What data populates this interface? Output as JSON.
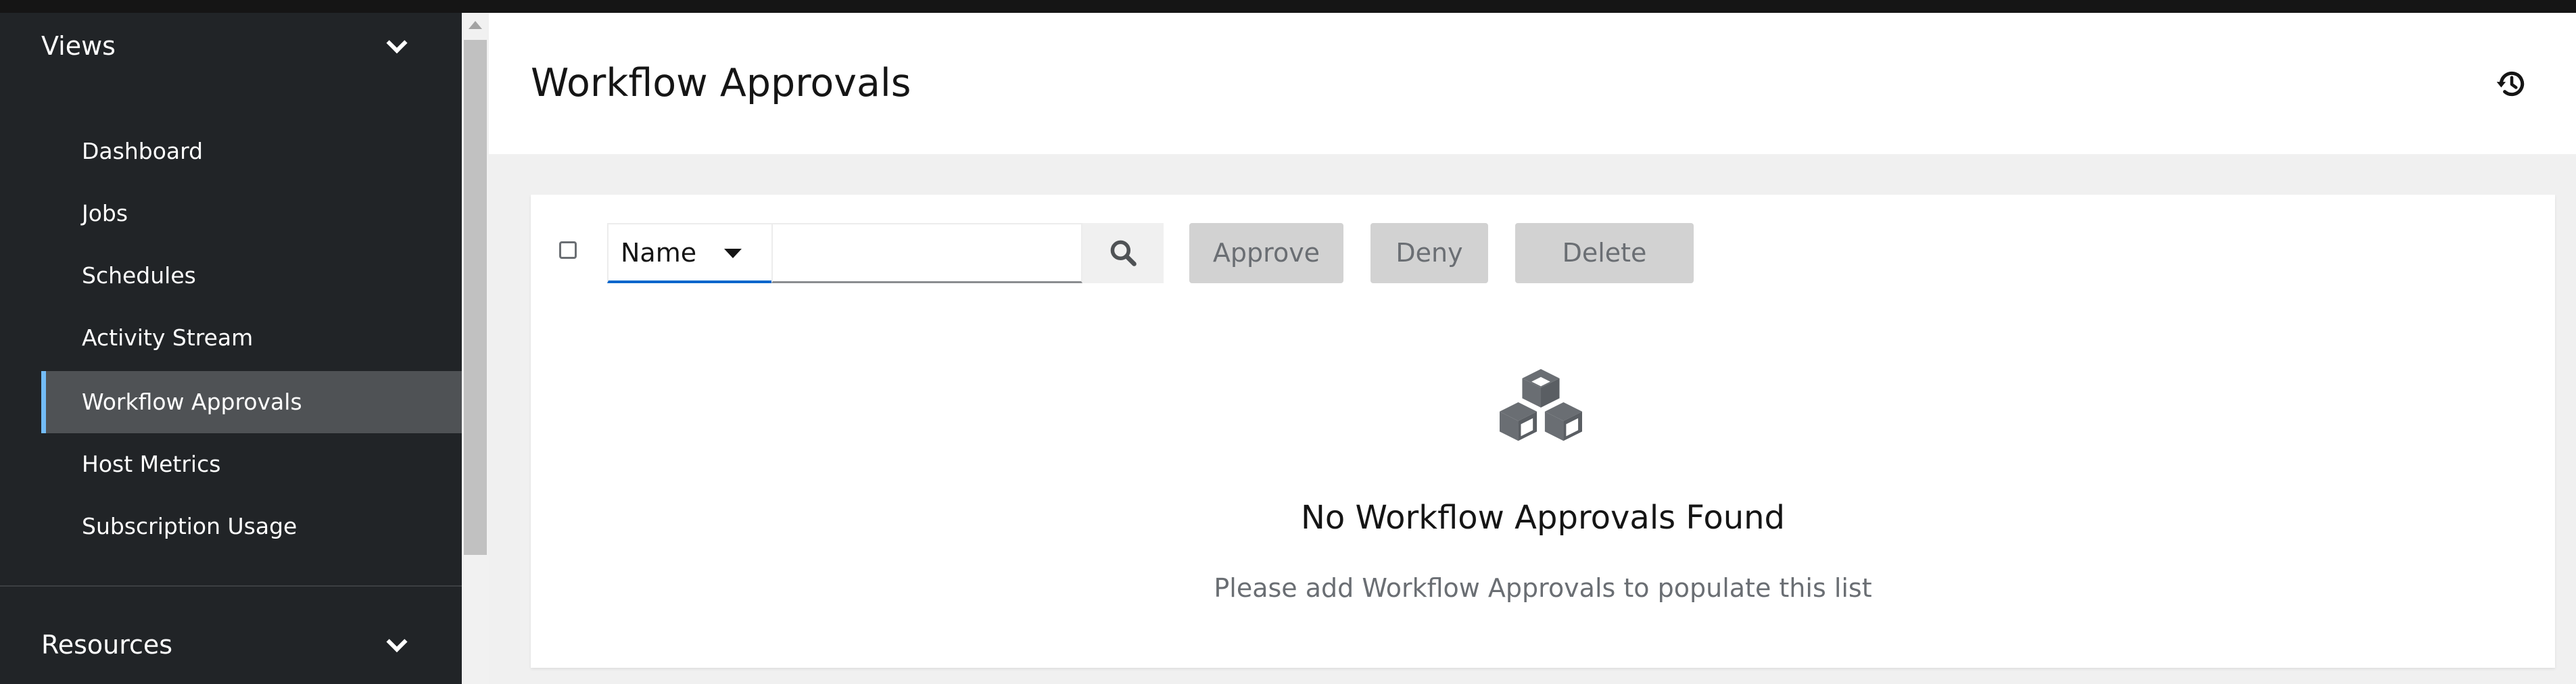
{
  "sidebar": {
    "views_group": {
      "label": "Views"
    },
    "items": [
      {
        "label": "Dashboard"
      },
      {
        "label": "Jobs"
      },
      {
        "label": "Schedules"
      },
      {
        "label": "Activity Stream"
      },
      {
        "label": "Workflow Approvals",
        "active": true
      },
      {
        "label": "Host Metrics"
      },
      {
        "label": "Subscription Usage"
      }
    ],
    "resources_group": {
      "label": "Resources"
    }
  },
  "header": {
    "title": "Workflow Approvals",
    "history_icon": "history-icon"
  },
  "toolbar": {
    "filter_field": "Name",
    "search_value": "",
    "search_icon": "search-icon",
    "approve_label": "Approve",
    "deny_label": "Deny",
    "delete_label": "Delete"
  },
  "empty_state": {
    "icon": "cubes-icon",
    "title": "No Workflow Approvals Found",
    "body": "Please add Workflow Approvals to populate this list"
  },
  "colors": {
    "sidebar_bg": "#212427",
    "active_item_bg": "#4f5255",
    "active_indicator": "#73bcf7",
    "disabled_button": "#d2d2d2",
    "focus_underline": "#0066cc"
  }
}
